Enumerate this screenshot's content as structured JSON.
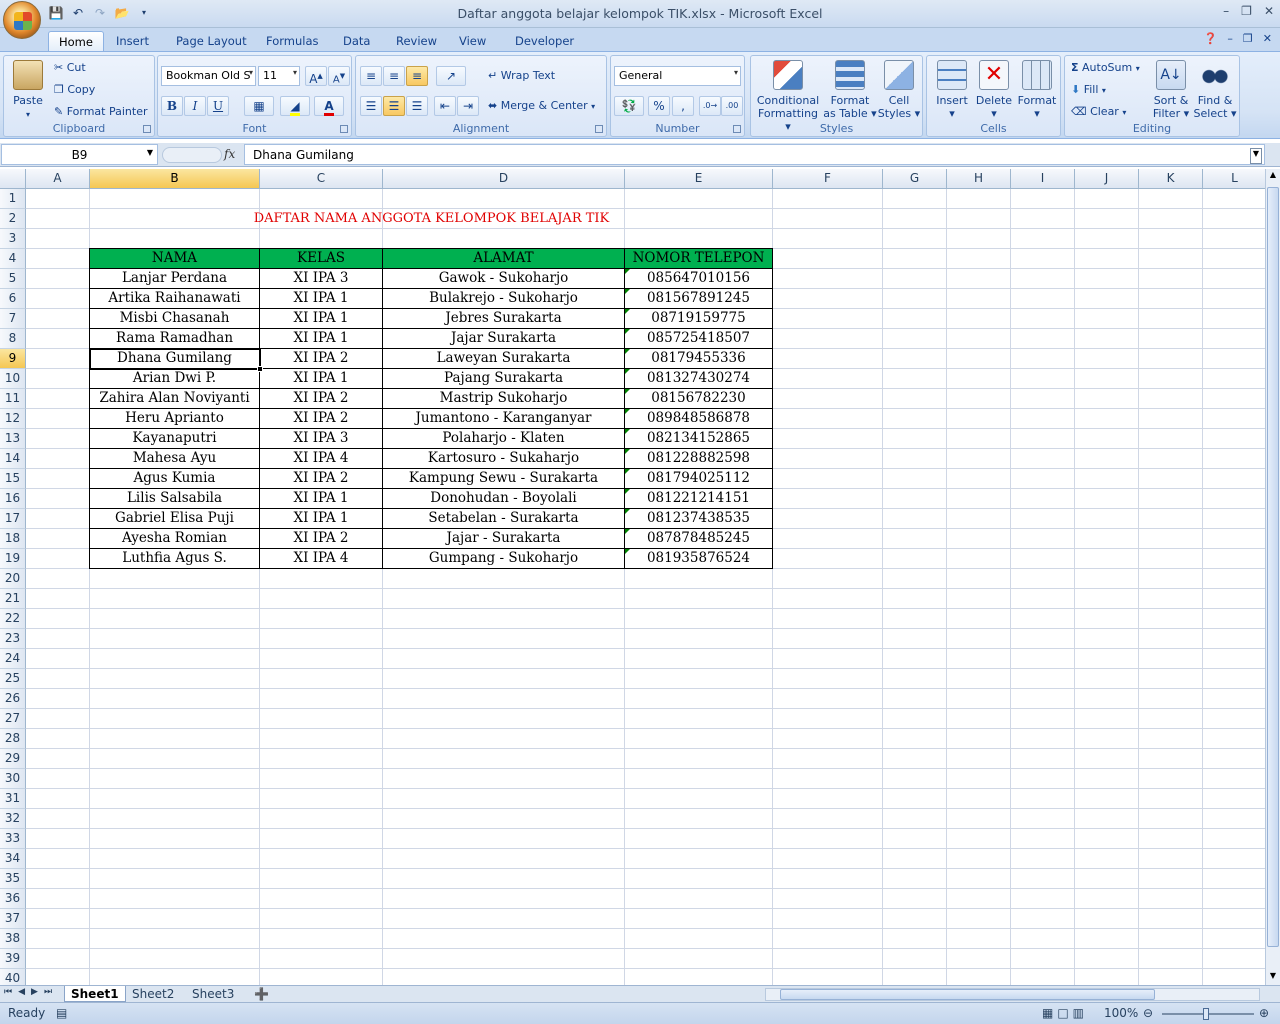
{
  "app": {
    "window_title": "Daftar anggota belajar kelompok TIK.xlsx - Microsoft Excel"
  },
  "ribbon": {
    "tabs": [
      "Home",
      "Insert",
      "Page Layout",
      "Formulas",
      "Data",
      "Review",
      "View",
      "Developer"
    ],
    "active_tab": "Home",
    "clipboard": {
      "label": "Clipboard",
      "paste": "Paste",
      "cut": "Cut",
      "copy": "Copy",
      "format_painter": "Format Painter"
    },
    "font": {
      "label": "Font",
      "family": "Bookman Old S",
      "size": "11",
      "bold": "B",
      "italic": "I",
      "underline": "U"
    },
    "alignment": {
      "label": "Alignment",
      "wrap_text": "Wrap Text",
      "merge_center": "Merge & Center"
    },
    "number": {
      "label": "Number",
      "format": "General",
      "percent": "%",
      "comma": ","
    },
    "styles": {
      "label": "Styles",
      "conditional_1": "Conditional",
      "conditional_2": "Formatting",
      "format_table_1": "Format",
      "format_table_2": "as Table",
      "cell_styles_1": "Cell",
      "cell_styles_2": "Styles"
    },
    "cells": {
      "label": "Cells",
      "insert": "Insert",
      "delete": "Delete",
      "format": "Format"
    },
    "editing": {
      "label": "Editing",
      "autosum": "AutoSum",
      "fill": "Fill",
      "clear": "Clear",
      "sort_1": "Sort &",
      "sort_2": "Filter",
      "find_1": "Find &",
      "find_2": "Select"
    }
  },
  "formula_bar": {
    "name_box": "B9",
    "fx": "fx",
    "content": "Dhana Gumilang"
  },
  "columns": [
    "A",
    "B",
    "C",
    "D",
    "E",
    "F",
    "G",
    "H",
    "I",
    "J",
    "K",
    "L"
  ],
  "selected_cell": {
    "column": "B",
    "row": 9
  },
  "sheet": {
    "title": "DAFTAR NAMA ANGGOTA KELOMPOK BELAJAR TIK",
    "headers": [
      "NAMA",
      "KELAS",
      "ALAMAT",
      "NOMOR TELEPON"
    ],
    "rows": [
      [
        "Lanjar Perdana",
        "XI IPA 3",
        "Gawok - Sukoharjo",
        "085647010156"
      ],
      [
        "Artika Raihanawati",
        "XI IPA 1",
        "Bulakrejo - Sukoharjo",
        "081567891245"
      ],
      [
        "Misbi Chasanah",
        "XI IPA 1",
        "Jebres Surakarta",
        "08719159775"
      ],
      [
        "Rama Ramadhan",
        "XI IPA 1",
        "Jajar Surakarta",
        "085725418507"
      ],
      [
        "Dhana Gumilang",
        "XI IPA 2",
        "Laweyan Surakarta",
        "08179455336"
      ],
      [
        "Arian Dwi P.",
        "XI IPA 1",
        "Pajang Surakarta",
        "081327430274"
      ],
      [
        "Zahira Alan Noviyanti",
        "XI IPA 2",
        "Mastrip Sukoharjo",
        "08156782230"
      ],
      [
        "Heru Aprianto",
        "XI IPA 2",
        "Jumantono - Karanganyar",
        "089848586878"
      ],
      [
        "Kayanaputri",
        "XI IPA 3",
        "Polaharjo - Klaten",
        "082134152865"
      ],
      [
        "Mahesa Ayu",
        "XI IPA 4",
        "Kartosuro - Sukaharjo",
        "081228882598"
      ],
      [
        "Agus Kumia",
        "XI IPA 2",
        "Kampung Sewu - Surakarta",
        "081794025112"
      ],
      [
        "Lilis Salsabila",
        "XI IPA 1",
        "Donohudan - Boyolali",
        "081221214151"
      ],
      [
        "Gabriel Elisa Puji",
        "XI IPA 1",
        "Setabelan - Surakarta",
        "081237438535"
      ],
      [
        "Ayesha Romian",
        "XI IPA 2",
        "Jajar - Surakarta",
        "087878485245"
      ],
      [
        "Luthfia Agus S.",
        "XI IPA 4",
        "Gumpang - Sukoharjo",
        "081935876524"
      ]
    ]
  },
  "sheet_tabs": [
    "Sheet1",
    "Sheet2",
    "Sheet3"
  ],
  "active_sheet": "Sheet1",
  "status": {
    "ready": "Ready",
    "zoom": "100%"
  },
  "colors": {
    "header_fill": "#00b050",
    "title_text": "#e00000",
    "selection_header": "#f5c753"
  }
}
